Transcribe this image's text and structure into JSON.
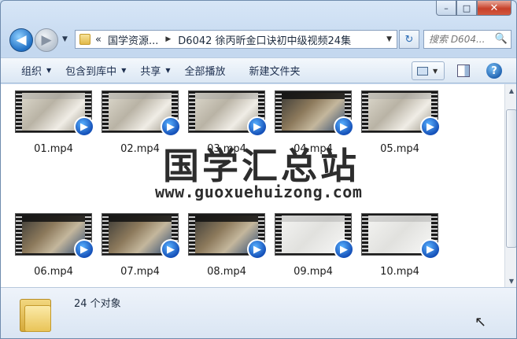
{
  "window": {
    "caption": {
      "minimize": "–",
      "maximize": "□",
      "close": "✕"
    }
  },
  "nav": {
    "back_icon": "back-arrow-icon",
    "forward_icon": "forward-arrow-icon",
    "back_glyph": "◀",
    "forward_glyph": "▶",
    "recent_glyph": "▼",
    "breadcrumb": {
      "overflow": "«",
      "root": "国学资源...",
      "separator": "▶",
      "current": "D6042 徐丙昕金口诀初中级视频24集",
      "drop": "▼"
    },
    "refresh_glyph": "↻",
    "search": {
      "placeholder": "搜索 D604...",
      "icon": "🔍"
    }
  },
  "toolbar": {
    "organize": "组织",
    "include_in_library": "包含到库中",
    "share": "共享",
    "play_all": "全部播放",
    "new_folder": "新建文件夹",
    "dropdown_glyph": "▼",
    "help_glyph": "?"
  },
  "files": [
    {
      "name": "01.mp4",
      "style": "mid"
    },
    {
      "name": "02.mp4",
      "style": "mid"
    },
    {
      "name": "03.mp4",
      "style": "mid"
    },
    {
      "name": "04.mp4",
      "style": "dark"
    },
    {
      "name": "05.mp4",
      "style": "mid"
    },
    {
      "name": "06.mp4",
      "style": "dark"
    },
    {
      "name": "07.mp4",
      "style": "dark"
    },
    {
      "name": "08.mp4",
      "style": "dark"
    },
    {
      "name": "09.mp4",
      "style": "light"
    },
    {
      "name": "10.mp4",
      "style": "light"
    }
  ],
  "watermark": {
    "chinese": "国学汇总站",
    "url": "www.guoxuehuizong.com"
  },
  "scroll": {
    "up": "▲",
    "down": "▼"
  },
  "status": {
    "count_text": "24 个对象"
  },
  "cursor_glyph": "↖"
}
